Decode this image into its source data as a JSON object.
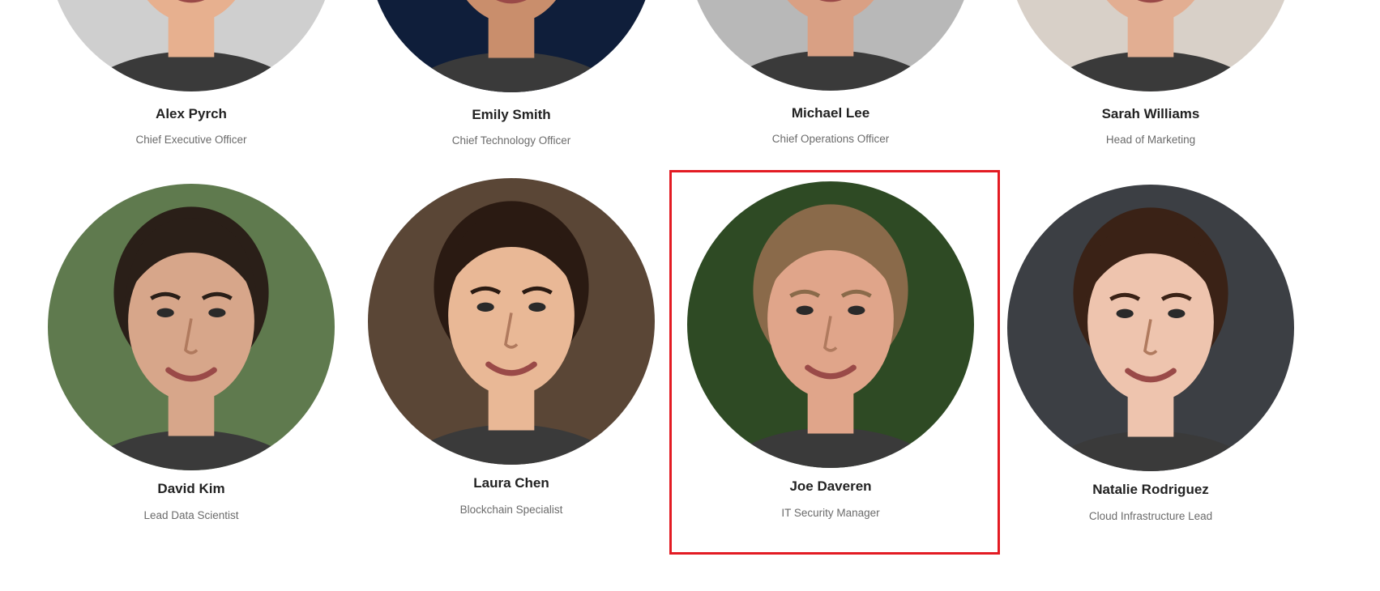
{
  "team": {
    "members": [
      {
        "name": "Alex Pyrch",
        "role": "Chief Executive Officer",
        "avatar_icon": "person-photo-icon",
        "bg": "#cfcfcf",
        "skin": "#e7b08f",
        "hair": "#6b4a32"
      },
      {
        "name": "Emily Smith",
        "role": "Chief Technology Officer",
        "avatar_icon": "person-photo-icon",
        "bg": "#0f1e3a",
        "skin": "#c98e6c",
        "hair": "#2a1a12"
      },
      {
        "name": "Michael Lee",
        "role": "Chief Operations Officer",
        "avatar_icon": "person-photo-icon",
        "bg": "#b8b8b8",
        "skin": "#d9a084",
        "hair": "#2b2018"
      },
      {
        "name": "Sarah Williams",
        "role": "Head of Marketing",
        "avatar_icon": "person-photo-icon",
        "bg": "#d8d0c8",
        "skin": "#e2ae92",
        "hair": "#3a2418"
      },
      {
        "name": "David Kim",
        "role": "Lead Data Scientist",
        "avatar_icon": "person-photo-icon",
        "bg": "#5f7a4e",
        "skin": "#d7a68a",
        "hair": "#2a1f18"
      },
      {
        "name": "Laura Chen",
        "role": "Blockchain Specialist",
        "avatar_icon": "person-photo-icon",
        "bg": "#5a4636",
        "skin": "#e9b896",
        "hair": "#2a1a12"
      },
      {
        "name": "Joe Daveren",
        "role": "IT Security Manager",
        "avatar_icon": "person-photo-icon",
        "bg": "#2e4a24",
        "skin": "#e0a58a",
        "hair": "#8a6a4a"
      },
      {
        "name": "Natalie Rodriguez",
        "role": "Cloud Infrastructure Lead",
        "avatar_icon": "person-photo-icon",
        "bg": "#3c3f44",
        "skin": "#eec4ae",
        "hair": "#3a2216"
      }
    ]
  },
  "selection": {
    "highlighted_member": "Joe Daveren",
    "color": "#e31b23"
  }
}
